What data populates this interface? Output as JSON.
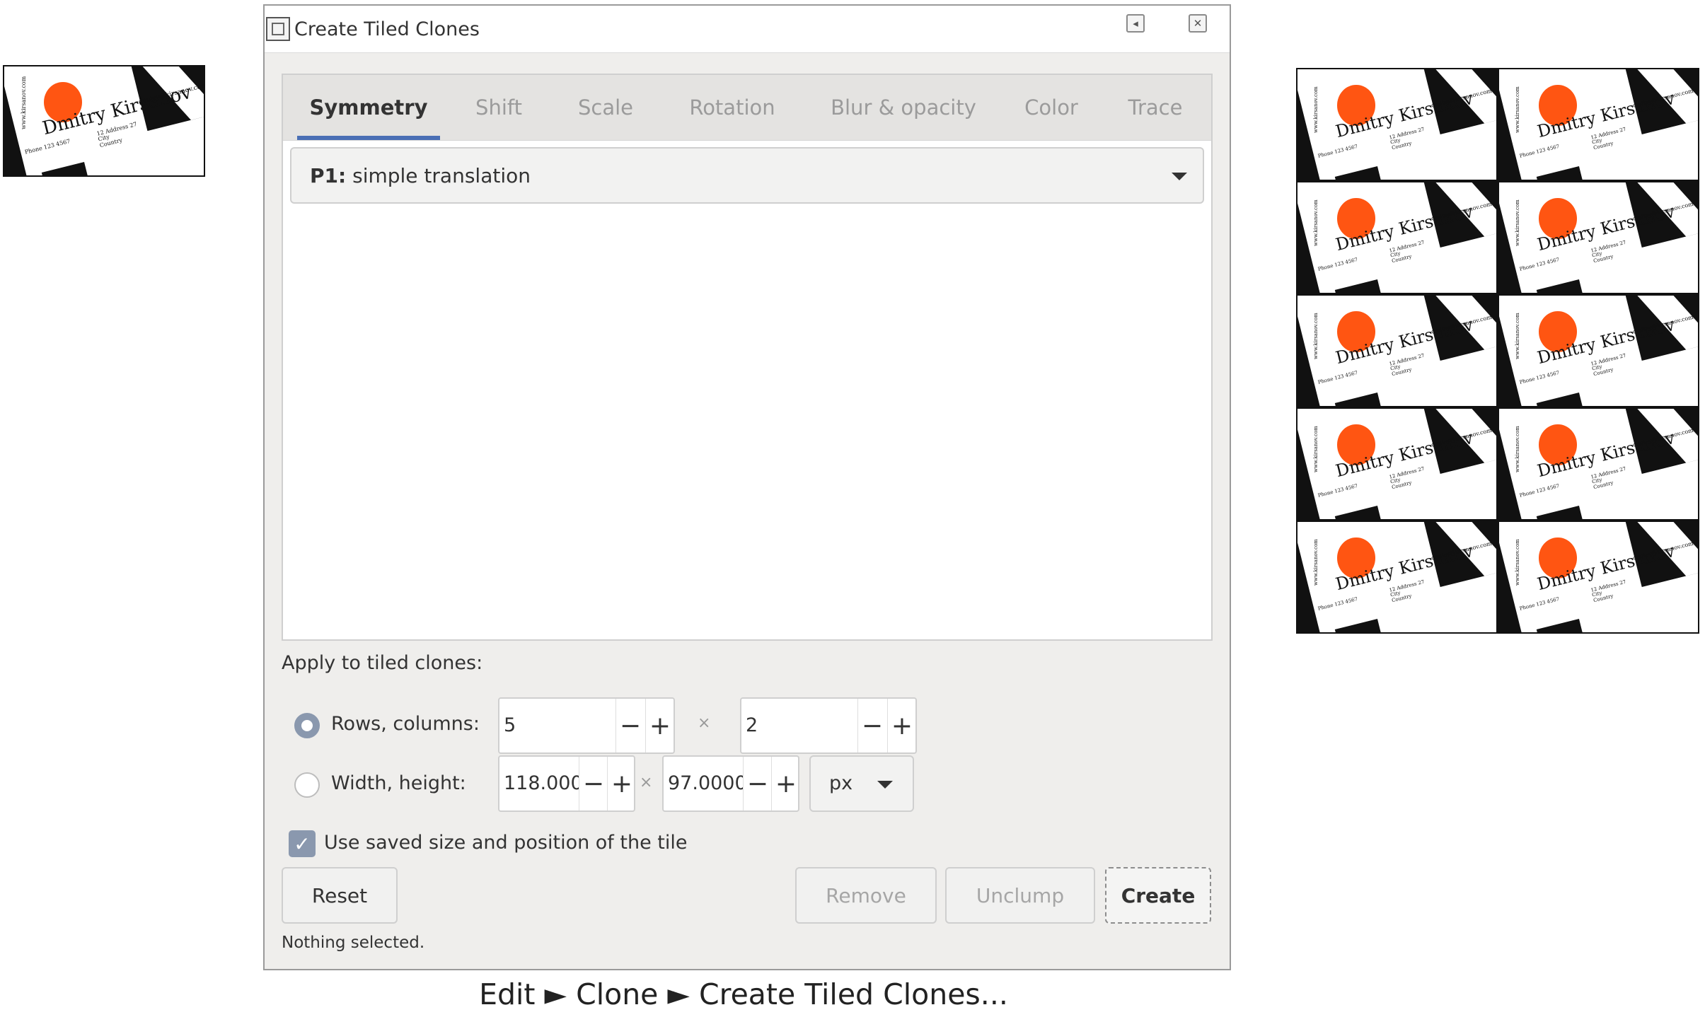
{
  "card": {
    "name": "Dmitry Kirsanov",
    "email": "dmitry@kirsanov.com",
    "address": [
      "12 Address 27",
      "City",
      "Country"
    ],
    "phone": "Phone 123 4567",
    "web": "www.kirsanov.com",
    "accent_color": "#ff5512"
  },
  "dialog": {
    "title": "Create Tiled Clones",
    "title_icon": "tiled-clones-dialog-icon",
    "tabs": [
      {
        "label": "Symmetry",
        "active": true
      },
      {
        "label": "Shift",
        "active": false
      },
      {
        "label": "Scale",
        "active": false
      },
      {
        "label": "Rotation",
        "active": false
      },
      {
        "label": "Blur & opacity",
        "active": false
      },
      {
        "label": "Color",
        "active": false
      },
      {
        "label": "Trace",
        "active": false
      }
    ],
    "symmetry": {
      "prefix": "P1:",
      "value": "simple translation"
    },
    "apply_label": "Apply to tiled clones:",
    "rows_columns": {
      "label": "Rows, columns:",
      "rows": "5",
      "columns": "2",
      "selected": true
    },
    "width_height": {
      "label": "Width, height:",
      "width": "118.0000",
      "height": "97.0000",
      "unit": "px",
      "selected": false
    },
    "times_symbol": "×",
    "minus": "−",
    "plus": "+",
    "use_saved": {
      "label": "Use saved size and position of the tile",
      "checked": true
    },
    "buttons": {
      "reset": "Reset",
      "remove": "Remove",
      "unclump": "Unclump",
      "create": "Create"
    },
    "status": "Nothing selected.",
    "accent_color": "#4a6fb5"
  },
  "caption": "Edit ► Clone ► Create Tiled Clones..."
}
